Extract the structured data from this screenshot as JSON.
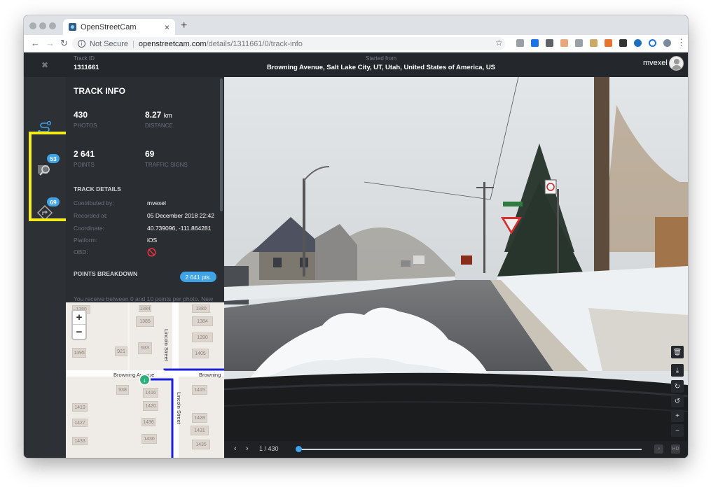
{
  "browser": {
    "tab_title": "OpenStreetCam",
    "tab_close": "×",
    "new_tab": "+",
    "not_secure": "Not Secure",
    "url_host": "openstreetcam.com",
    "url_path": "/details/1311661/0/track-info"
  },
  "header": {
    "track_id_label": "Track ID",
    "track_id": "1311661",
    "started_from_label": "Started from",
    "started_from": "Browning Avenue, Salt Lake City, UT, Utah, United States of America, US",
    "username": "mvexel"
  },
  "rail": {
    "photos_badge": "53",
    "signs_badge": "69"
  },
  "panel": {
    "title": "TRACK INFO",
    "photos_value": "430",
    "photos_label": "PHOTOS",
    "distance_value": "8.27",
    "distance_unit": "km",
    "distance_label": "DISTANCE",
    "points_value": "2 641",
    "points_label": "POINTS",
    "signs_value": "69",
    "signs_label": "TRAFFIC SIGNS",
    "details_title": "TRACK DETAILS",
    "contributed_label": "Contributed by:",
    "contributed_value": "mvexel",
    "recorded_label": "Recorded at:",
    "recorded_value": "05 December 2018 22:42",
    "coordinate_label": "Coordinate:",
    "coordinate_value": "40.739096, -111.864281",
    "platform_label": "Platform:",
    "platform_value": "iOS",
    "obd_label": "OBD:",
    "breakdown_title": "POINTS BREAKDOWN",
    "points_badge": "2 641 pts.",
    "note": "You receive between 0 and 10 points per photo. New"
  },
  "map": {
    "zoom_in": "+",
    "zoom_out": "−",
    "street_browning": "Browning Avenue",
    "street_browning_east": "Browning",
    "street_lincoln": "Lincoln Street",
    "parcels": [
      "1380",
      "1384",
      "1385",
      "1395",
      "921",
      "933",
      "938",
      "1380",
      "1384",
      "1390",
      "1405",
      "1415",
      "1416",
      "1419",
      "1420",
      "1427",
      "1428",
      "1431",
      "1433",
      "1430",
      "1435",
      "1436"
    ]
  },
  "viewer": {
    "prev": "‹",
    "next": "›",
    "counter": "1 / 430",
    "progress": 0.002,
    "side_buttons": [
      "delete",
      "download",
      "rotate-right",
      "rotate-left",
      "zoom-in",
      "zoom-out"
    ]
  },
  "colors": {
    "accent": "#3fa3e8",
    "highlight": "#f1ea1e",
    "route": "#1a22d8",
    "start_pin": "#2fb07b"
  }
}
